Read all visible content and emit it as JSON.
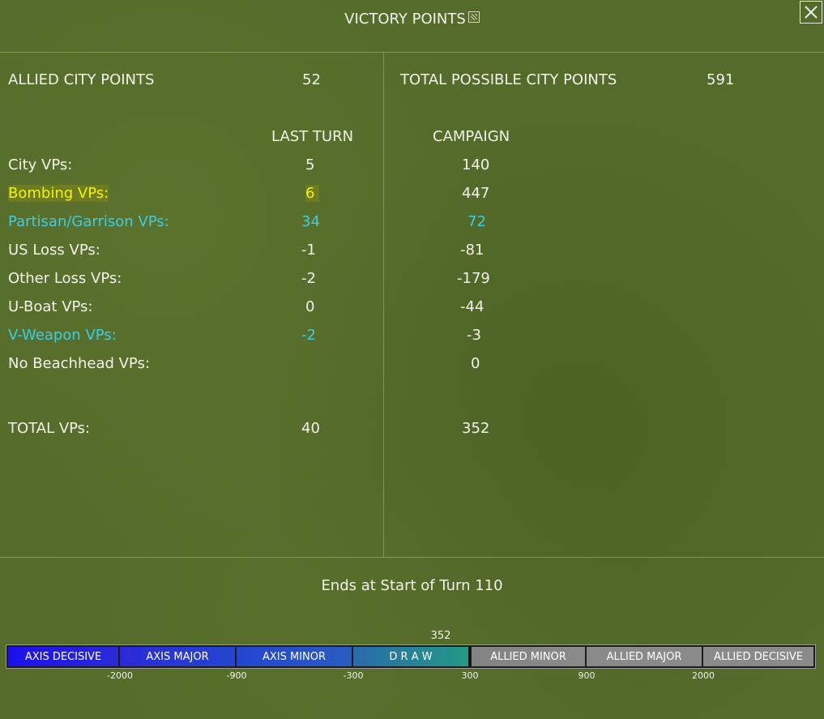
{
  "window": {
    "title": "VICTORY POINTS",
    "title_icon": "window-icon",
    "close_icon": "close-icon"
  },
  "summary": {
    "allied_city_points_label": "ALLIED CITY POINTS",
    "allied_city_points_value": "52",
    "total_possible_label": "TOTAL POSSIBLE CITY POINTS",
    "total_possible_value": "591"
  },
  "headers": {
    "last_turn": "LAST TURN",
    "campaign": "CAMPAIGN"
  },
  "rows": [
    {
      "label": "City VPs:",
      "last": "5",
      "campaign": "140"
    },
    {
      "label": "Bombing VPs:",
      "last": "6",
      "campaign": "447"
    },
    {
      "label": "Partisan/Garrison VPs:",
      "last": "34",
      "campaign": "72"
    },
    {
      "label": "US Loss VPs:",
      "last": "-1",
      "campaign": "-81"
    },
    {
      "label": "Other Loss VPs:",
      "last": "-2",
      "campaign": "-179"
    },
    {
      "label": "U-Boat VPs:",
      "last": "0",
      "campaign": "-44"
    },
    {
      "label": "V-Weapon VPs:",
      "last": "-2",
      "campaign": "-3"
    },
    {
      "label": "No Beachhead VPs:",
      "last": "",
      "campaign": "0"
    }
  ],
  "total": {
    "label": "TOTAL VPs:",
    "last": "40",
    "campaign": "352"
  },
  "ends_text": "Ends at Start of Turn 110",
  "scale": {
    "current_value": "352",
    "segments": [
      "AXIS DECISIVE",
      "AXIS MAJOR",
      "AXIS MINOR",
      "D R A W",
      "ALLIED MINOR",
      "ALLIED MAJOR",
      "ALLIED DECISIVE"
    ],
    "ticks": [
      "-2000",
      "-900",
      "-300",
      "300",
      "900",
      "2000"
    ]
  },
  "colors": {
    "background": "#556b2a",
    "text": "#f2f2ea",
    "bombing_highlight": "#f4f400",
    "partisan_vweapon": "#3ecde0",
    "axis_segment": "#1e3cd8",
    "draw_segment": "#1f8a8a",
    "allied_segment": "#8a8a8a"
  }
}
